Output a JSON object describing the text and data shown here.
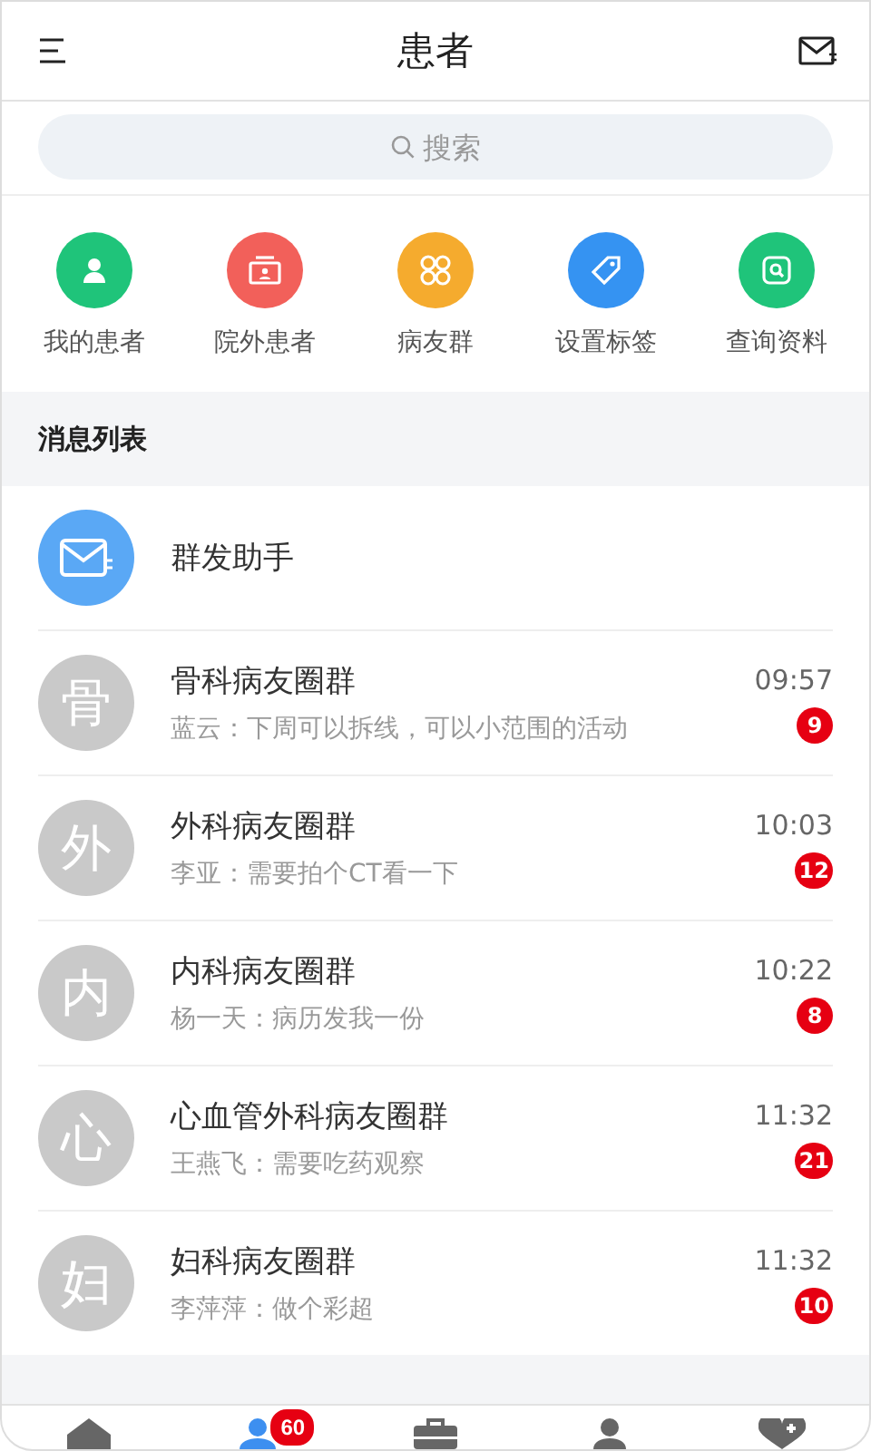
{
  "header": {
    "title": "患者"
  },
  "search": {
    "placeholder": "搜索"
  },
  "shortcuts": [
    {
      "label": "我的患者",
      "kind": "patient",
      "color": "#1fc47a"
    },
    {
      "label": "院外患者",
      "kind": "card",
      "color": "#f2605a"
    },
    {
      "label": "病友群",
      "kind": "group",
      "color": "#f5ab2e"
    },
    {
      "label": "设置标签",
      "kind": "tag",
      "color": "#3593f2"
    },
    {
      "label": "查询资料",
      "kind": "lookup",
      "color": "#1fc47a"
    }
  ],
  "section_title": "消息列表",
  "broadcast": {
    "title": "群发助手"
  },
  "chats": [
    {
      "avatar": "骨",
      "name": "骨科病友圈群",
      "message": "蓝云：下周可以拆线，可以小范围的活动",
      "time": "09:57",
      "unread": "9"
    },
    {
      "avatar": "外",
      "name": "外科病友圈群",
      "message": "李亚：需要拍个CT看一下",
      "time": "10:03",
      "unread": "12"
    },
    {
      "avatar": "内",
      "name": "内科病友圈群",
      "message": "杨一天：病历发我一份",
      "time": "10:22",
      "unread": "8"
    },
    {
      "avatar": "心",
      "name": "心血管外科病友圈群",
      "message": "王燕飞：需要吃药观察",
      "time": "11:32",
      "unread": "21"
    },
    {
      "avatar": "妇",
      "name": "妇科病友圈群",
      "message": "李萍萍：做个彩超",
      "time": "11:32",
      "unread": "10"
    }
  ],
  "tabbar": [
    {
      "kind": "home",
      "selected": false
    },
    {
      "kind": "patients",
      "selected": true,
      "badge": "60"
    },
    {
      "kind": "kit",
      "selected": false
    },
    {
      "kind": "person",
      "selected": false
    },
    {
      "kind": "heart",
      "selected": false
    }
  ]
}
